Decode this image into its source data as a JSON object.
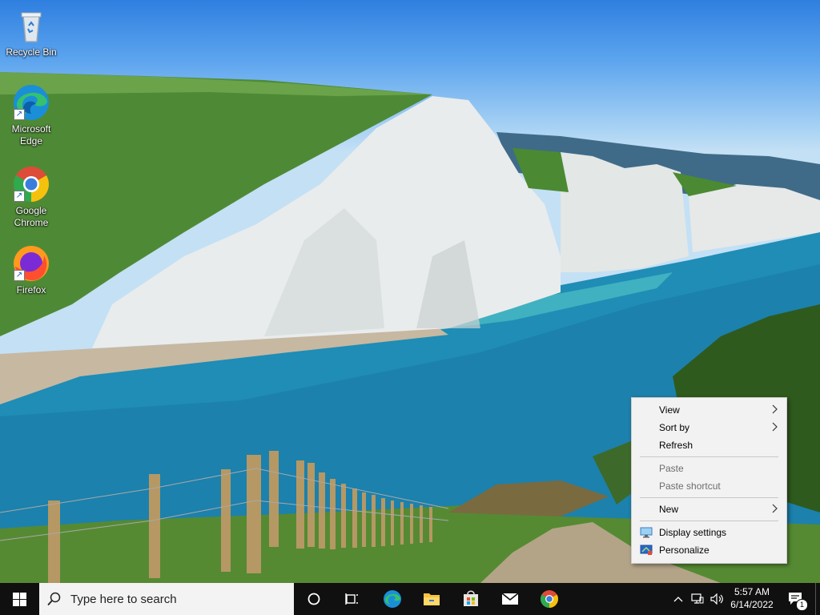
{
  "desktop": {
    "icons": [
      {
        "label": "Recycle Bin",
        "icon": "recycle-bin-icon"
      },
      {
        "label": "Microsoft Edge",
        "icon": "edge-icon"
      },
      {
        "label": "Google Chrome",
        "icon": "chrome-icon"
      },
      {
        "label": "Firefox",
        "icon": "firefox-icon"
      }
    ]
  },
  "context_menu": {
    "view": "View",
    "sort_by": "Sort by",
    "refresh": "Refresh",
    "paste": "Paste",
    "paste_shortcut": "Paste shortcut",
    "new": "New",
    "display_settings": "Display settings",
    "personalize": "Personalize"
  },
  "taskbar": {
    "search_placeholder": "Type here to search",
    "pinned": [
      "cortana-icon",
      "task-view-icon",
      "edge-icon",
      "file-explorer-icon",
      "store-icon",
      "mail-icon",
      "chrome-icon"
    ],
    "time": "5:57 AM",
    "date": "6/14/2022",
    "notification_count": "1"
  },
  "colors": {
    "taskbar": "#101010",
    "menu_bg": "#f2f2f2",
    "sea": "#1f8db5",
    "cliff": "#e9ecec",
    "grass": "#4e8a36"
  }
}
